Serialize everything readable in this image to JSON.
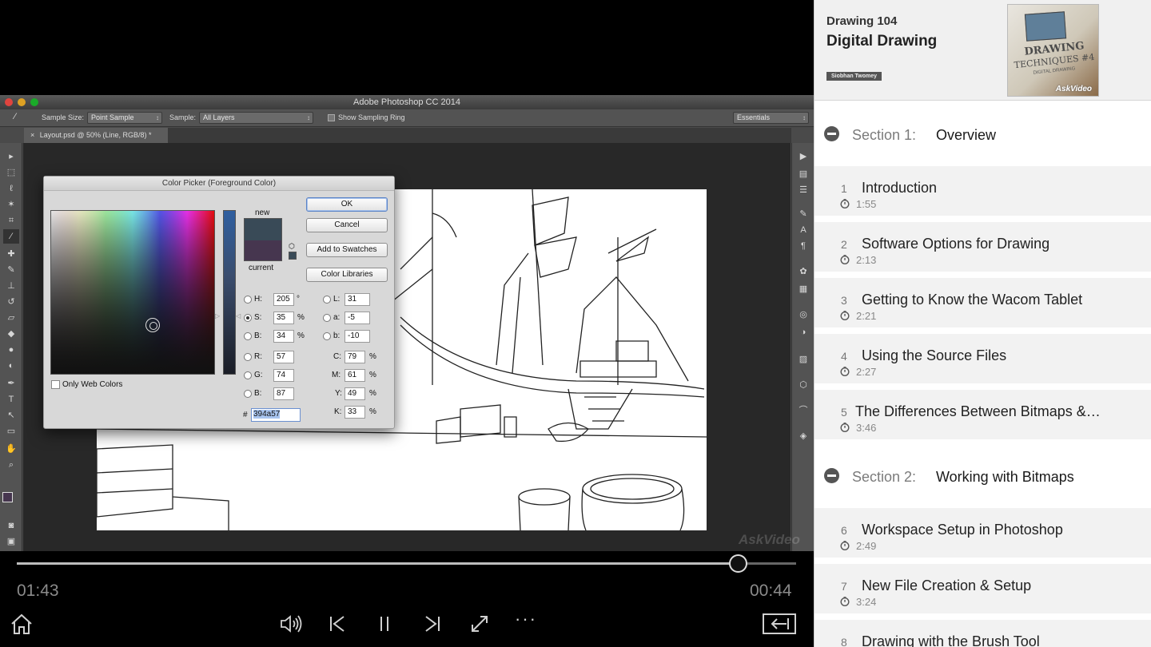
{
  "photoshop": {
    "app_title": "Adobe Photoshop CC 2014",
    "options": {
      "sample_size_label": "Sample Size:",
      "sample_size_value": "Point Sample",
      "sample_label": "Sample:",
      "sample_value": "All Layers",
      "show_ring_label": "Show Sampling Ring",
      "workspace_value": "Essentials"
    },
    "document_tab": "Layout.psd @ 50% (Line, RGB/8) *",
    "color_picker": {
      "title": "Color Picker (Foreground Color)",
      "new_label": "new",
      "current_label": "current",
      "new_color": "#394a57",
      "current_color": "#46364f",
      "ok_label": "OK",
      "cancel_label": "Cancel",
      "add_swatches_label": "Add to Swatches",
      "color_libraries_label": "Color Libraries",
      "only_web_label": "Only Web Colors",
      "H": {
        "label": "H:",
        "value": "205",
        "unit": "°"
      },
      "S": {
        "label": "S:",
        "value": "35",
        "unit": "%"
      },
      "Bv": {
        "label": "B:",
        "value": "34",
        "unit": "%"
      },
      "R": {
        "label": "R:",
        "value": "57"
      },
      "G": {
        "label": "G:",
        "value": "74"
      },
      "Bl": {
        "label": "B:",
        "value": "87"
      },
      "L": {
        "label": "L:",
        "value": "31"
      },
      "a": {
        "label": "a:",
        "value": "-5"
      },
      "b": {
        "label": "b:",
        "value": "-10"
      },
      "C": {
        "label": "C:",
        "value": "79",
        "unit": "%"
      },
      "M": {
        "label": "M:",
        "value": "61",
        "unit": "%"
      },
      "Y": {
        "label": "Y:",
        "value": "49",
        "unit": "%"
      },
      "K": {
        "label": "K:",
        "value": "33",
        "unit": "%"
      },
      "hash": "#",
      "hex": "394a57"
    }
  },
  "player": {
    "elapsed": "01:43",
    "remaining": "00:44",
    "progress": 0.925,
    "watermark": "AskVideo"
  },
  "course": {
    "subtitle": "Drawing 104",
    "title": "Digital Drawing",
    "author": "Siobhan Twomey",
    "thumb_title": "DRAWING",
    "thumb_sub": "TECHNIQUES #4",
    "thumb_small": "DIGITAL DRAWING",
    "thumb_brand": "AskVideo"
  },
  "sections": [
    {
      "number": "Section 1:",
      "name": "Overview",
      "lessons": [
        {
          "num": "1",
          "title": "Introduction",
          "duration": "1:55"
        },
        {
          "num": "2",
          "title": "Software Options for Drawing",
          "duration": "2:13"
        },
        {
          "num": "3",
          "title": "Getting to Know the Wacom Tablet",
          "duration": "2:21"
        },
        {
          "num": "4",
          "title": "Using the Source Files",
          "duration": "2:27"
        },
        {
          "num": "5",
          "title": "The Differences Between Bitmaps &…",
          "duration": "3:46"
        }
      ]
    },
    {
      "number": "Section 2:",
      "name": "Working with Bitmaps",
      "lessons": [
        {
          "num": "6",
          "title": "Workspace Setup in Photoshop",
          "duration": "2:49"
        },
        {
          "num": "7",
          "title": "New File Creation & Setup",
          "duration": "3:24"
        },
        {
          "num": "8",
          "title": "Drawing with the Brush Tool",
          "duration": ""
        }
      ]
    }
  ]
}
